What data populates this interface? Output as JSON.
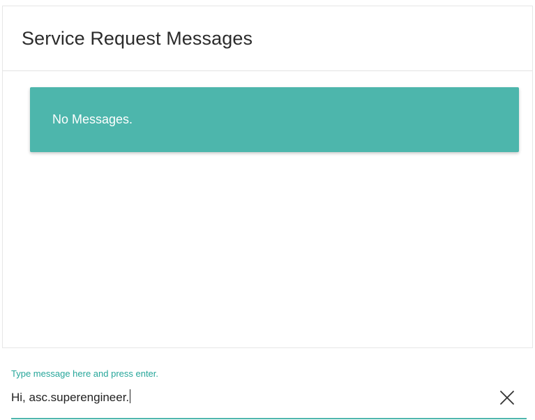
{
  "card": {
    "title": "Service Request Messages"
  },
  "messages": {
    "empty_text": "No Messages."
  },
  "composer": {
    "label": "Type message here and press enter.",
    "value": "Hi, asc.superengineer.",
    "clear_icon": "close-icon"
  },
  "colors": {
    "accent": "#4db6ac",
    "label": "#26a69a"
  }
}
